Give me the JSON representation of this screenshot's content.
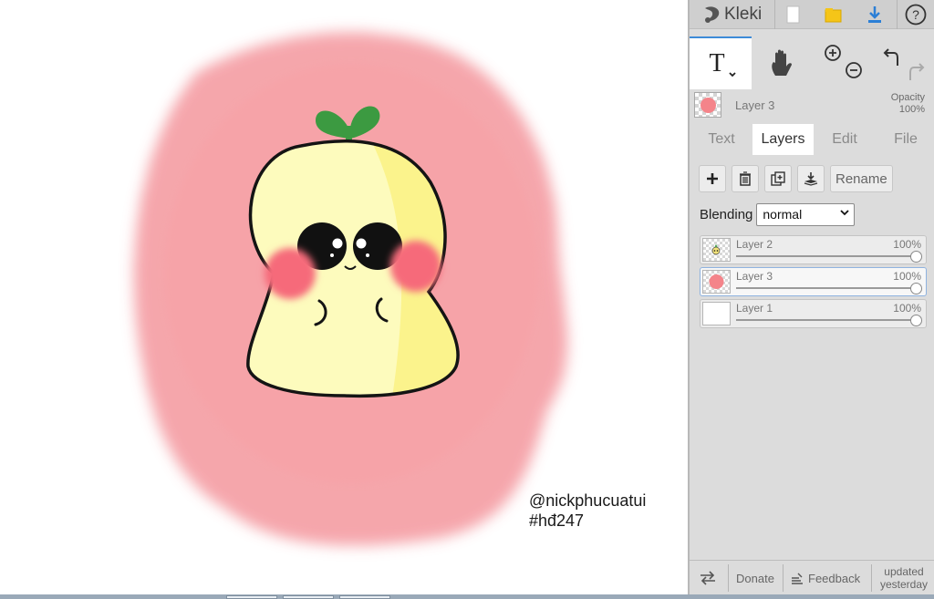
{
  "app": {
    "name": "Kleki"
  },
  "canvas": {
    "watermark": [
      "@nickphucuatui",
      "#hđ247"
    ],
    "colors": {
      "halo": "#f49aa0",
      "body": "#fdfbbd",
      "body_shade": "#fbf38c",
      "leaf": "#3c9a41",
      "cheek": "#f66a7a",
      "outline": "#141414"
    }
  },
  "toolbar": {
    "tools": [
      "text-tool-icon",
      "hand-tool-icon",
      "zoom-in-icon",
      "zoom-out-icon",
      "undo-icon",
      "redo-icon"
    ]
  },
  "current_layer": {
    "name": "Layer 3",
    "opacity_label": "Opacity",
    "opacity_value": "100%"
  },
  "tabs": [
    {
      "label": "Text",
      "active": false
    },
    {
      "label": "Layers",
      "active": true
    },
    {
      "label": "Edit",
      "active": false
    },
    {
      "label": "File",
      "active": false
    }
  ],
  "layer_actions": {
    "rename": "Rename"
  },
  "blending": {
    "label": "Blending",
    "value": "normal"
  },
  "layers": [
    {
      "name": "Layer 2",
      "opacity": "100%",
      "opacity_value": 1.0,
      "selected": false
    },
    {
      "name": "Layer 3",
      "opacity": "100%",
      "opacity_value": 1.0,
      "selected": true
    },
    {
      "name": "Layer 1",
      "opacity": "100%",
      "opacity_value": 1.0,
      "selected": false
    }
  ],
  "footer": {
    "donate": "Donate",
    "feedback": "Feedback",
    "updated_line1": "updated",
    "updated_line2": "yesterday"
  },
  "accent": "#3d8bd8"
}
